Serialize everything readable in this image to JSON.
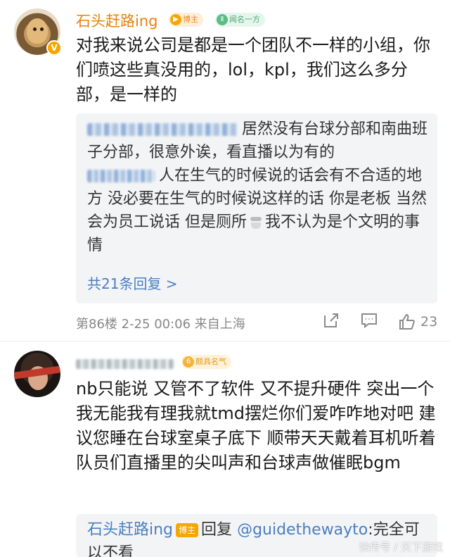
{
  "comments": [
    {
      "username": "石头赶路ing",
      "badges": {
        "bozhu": "博主",
        "mingyi": "闻名一方"
      },
      "text": "对我来说公司是都是一个团队不一样的小组，你们喷这些真没用的，lol，kpl，我们这么多分部，是一样的",
      "replies": [
        {
          "text": "居然没有台球分部和南曲班子分部，很意外诶，看直播以为有的"
        },
        {
          "text_before": "人在生气的时候说的话会有不合适的地方 没必要在生气的时候说这样的话 你是老板 当然会为员工说话 但是厕所",
          "text_after": "我不认为是个文明的事情"
        }
      ],
      "more_replies": "共21条回复 >",
      "meta": "第86楼 2-25 00:06 来自上海",
      "like_count": "23"
    },
    {
      "badges": {
        "gaomingqi": "颇具名气"
      },
      "text": "nb只能说 又管不了软件 又不提升硬件 突出一个我无能我有理我就tmd摆烂你们爱咋咋地对吧 建议您睡在台球室桌子底下 顺带天天戴着耳机听着队员们直播里的尖叫声和台球声做催眠bgm",
      "reply": {
        "username": "石头赶路ing",
        "badge": "博主",
        "reply_word": "回复",
        "mention": "@guidethewayto",
        "text": ":完全可以不看"
      }
    }
  ],
  "icons": [
    "verified-icon",
    "share-icon",
    "comment-icon",
    "like-icon",
    "toilet-emoji-icon"
  ],
  "colors": {
    "username": "#e8810e",
    "link": "#4a7fc1",
    "reply_bg": "#f3f4f6",
    "meta": "#888888"
  },
  "watermark": "快传号 / 天下游戏"
}
